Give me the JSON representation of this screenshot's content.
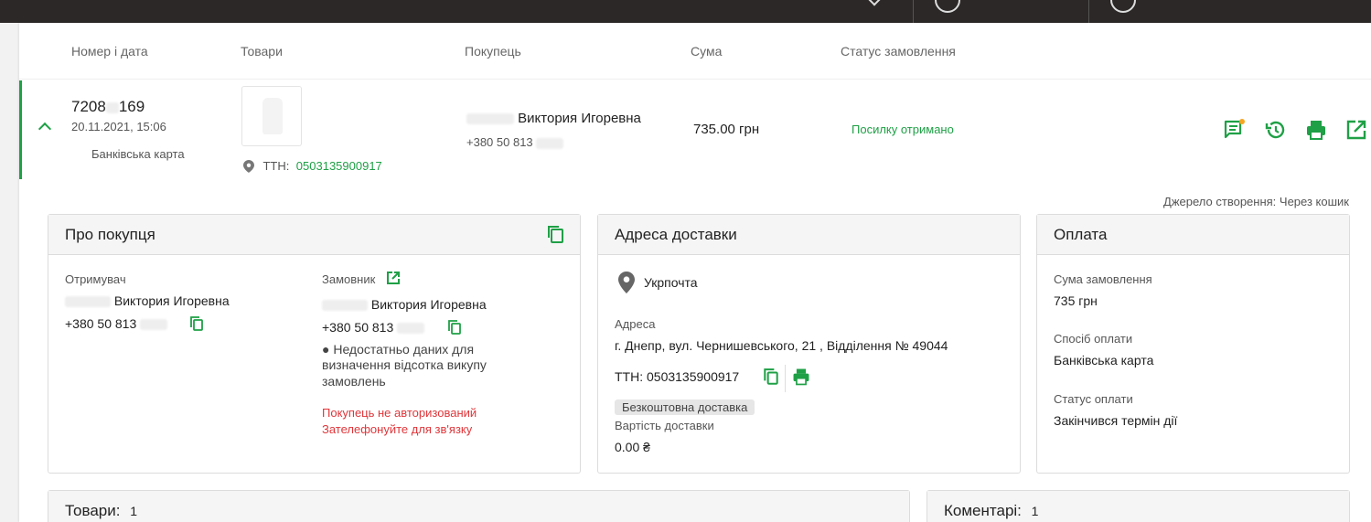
{
  "colors": {
    "accent": "#1fa046",
    "danger": "#e0363a",
    "topbar": "#2b2827"
  },
  "table_headers": {
    "number_date": "Номер і дата",
    "goods": "Товари",
    "buyer": "Покупець",
    "sum": "Сума",
    "status": "Статус замовлення"
  },
  "order": {
    "number_start": "7208",
    "number_end": "169",
    "datetime": "20.11.2021, 15:06",
    "payment": "Банківська карта",
    "ttn_label": "ТТН:",
    "ttn": "0503135900917",
    "buyer_name": "Виктория Игоревна",
    "buyer_phone": "+380 50 813",
    "sum": "735.00 грн",
    "status": "Посилку отримано",
    "actions": [
      "chat-icon",
      "history-icon",
      "print-icon",
      "open-external-icon"
    ]
  },
  "source": "Джерело створення: Через кошик",
  "buyer_card": {
    "title": "Про покупця",
    "recipient_label": "Отримувач",
    "recipient_name": "Виктория Игоревна",
    "recipient_phone": "+380 50 813",
    "customer_label": "Замовник",
    "customer_name": "Виктория Игоревна",
    "customer_phone": "+380 50 813",
    "info_line1": "● Недостатньо даних для",
    "info_line2": "визначення відсотка викупу",
    "info_line3": "замовлень",
    "warn1": "Покупець не авторизований",
    "warn2": "Зателефонуйте для зв'язку"
  },
  "delivery_card": {
    "title": "Адреса доставки",
    "carrier": "Укрпочта",
    "address_label": "Адреса",
    "address": "г. Днепр, вул. Чернишевського, 21 , Відділення № 49044",
    "ttn_label": "ТТН:",
    "ttn": "0503135900917",
    "free_tag": "Безкоштовна доставка",
    "cost_label": "Вартість доставки",
    "cost": "0.00 ₴"
  },
  "payment_card": {
    "title": "Оплата",
    "sum_label": "Сума замовлення",
    "sum": "735 грн",
    "method_label": "Спосіб оплати",
    "method": "Банківська карта",
    "status_label": "Статус оплати",
    "status": "Закінчився термін дії"
  },
  "goods_card": {
    "title": "Товари:",
    "count": "1"
  },
  "comments_card": {
    "title": "Коментарі:",
    "count": "1"
  }
}
